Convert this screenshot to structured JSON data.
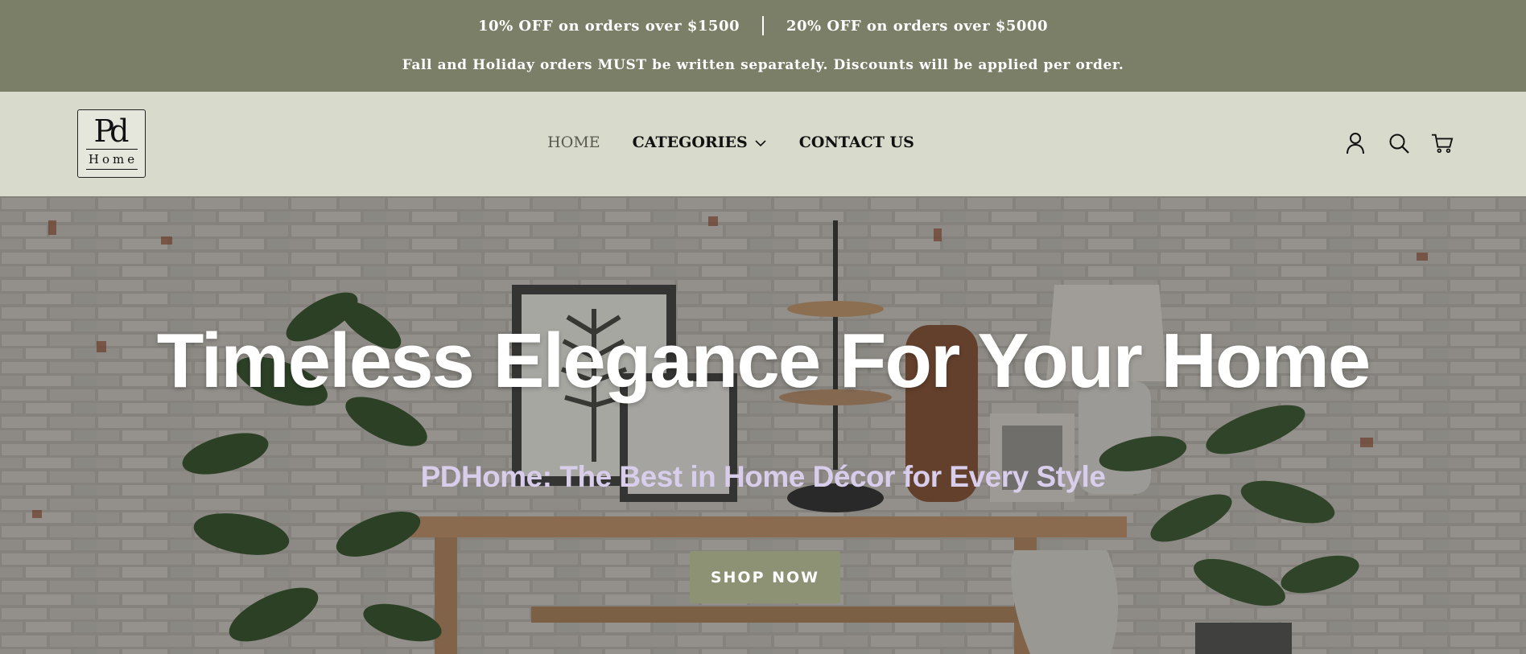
{
  "announcement": {
    "offer_1": "10% OFF on orders over $1500",
    "offer_2": "20% OFF on orders over $5000",
    "notice": "Fall and Holiday orders MUST be written separately. Discounts will be applied per order."
  },
  "header": {
    "logo": {
      "monogram": "Pd",
      "word": "Home"
    },
    "nav": [
      {
        "label": "HOME",
        "active": true
      },
      {
        "label": "CATEGORIES",
        "has_dropdown": true
      },
      {
        "label": "CONTACT US"
      }
    ],
    "icons": [
      "account-icon",
      "search-icon",
      "cart-icon"
    ]
  },
  "hero": {
    "title": "Timeless Elegance For Your Home",
    "subtitle": "PDHome: The Best in Home Décor for Every Style",
    "cta_label": "SHOP NOW"
  },
  "colors": {
    "announcement_bg": "#7b7f68",
    "header_bg": "#d8dacb",
    "cta_bg": "#8d9274",
    "subtitle_color": "#d8cdea"
  }
}
